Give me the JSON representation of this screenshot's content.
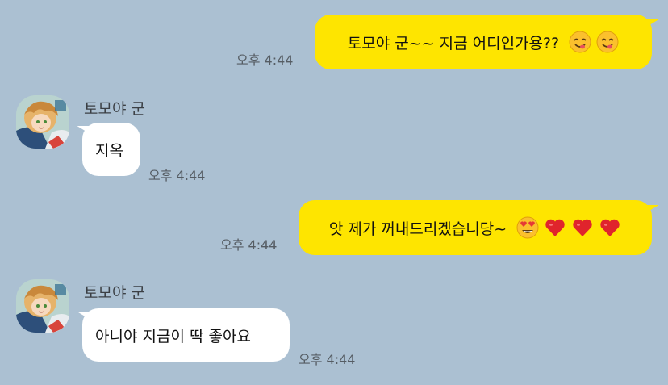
{
  "messages": [
    {
      "sender": "me",
      "text": "토모야 군~~ 지금 어디인가용??",
      "emojis": [
        "smiling-face-savoring-food-icon",
        "smiling-face-savoring-food-icon"
      ],
      "time": "오후 4:44"
    },
    {
      "sender": "토모야 군",
      "text": "지옥",
      "time": "오후 4:44"
    },
    {
      "sender": "me",
      "text": "앗 제가 꺼내드리겠습니당~",
      "emojis": [
        "heart-eyes-icon",
        "red-heart-icon",
        "red-heart-icon",
        "red-heart-icon"
      ],
      "time": "오후 4:44"
    },
    {
      "sender": "토모야 군",
      "text": "아니야 지금이 딱 좋아요",
      "time": "오후 4:44"
    }
  ],
  "colors": {
    "background": "#abc0d2",
    "my_bubble": "#fee500",
    "other_bubble": "#ffffff"
  }
}
